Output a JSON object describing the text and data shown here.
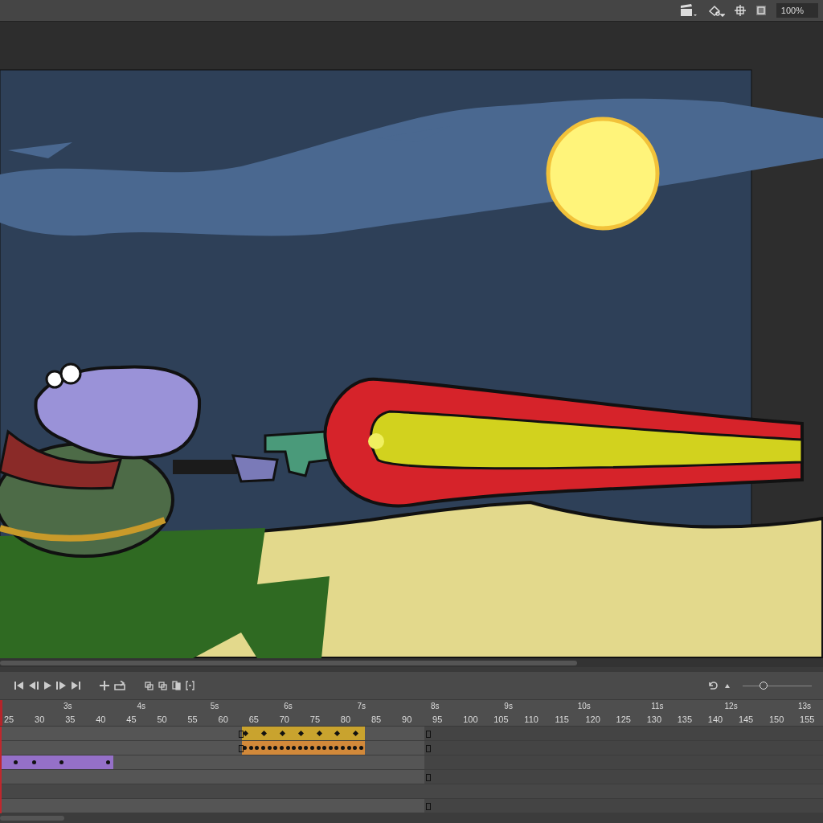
{
  "stage_toolbar": {
    "zoom": "100%"
  },
  "timeline": {
    "frame_labels": [
      "25",
      "30",
      "35",
      "40",
      "45",
      "50",
      "55",
      "60",
      "65",
      "70",
      "75",
      "80",
      "85",
      "90",
      "95",
      "100",
      "105",
      "110",
      "115",
      "120",
      "125",
      "130",
      "135",
      "140",
      "145",
      "150",
      "155"
    ],
    "second_labels": [
      "3s",
      "4s",
      "5s",
      "6s",
      "7s",
      "8s",
      "9s",
      "10s",
      "11s",
      "12s",
      "13s"
    ],
    "zoom_slider": {
      "level": 0.3
    },
    "layers": [
      {
        "kind": "motion-tween"
      },
      {
        "kind": "classic-tween"
      },
      {
        "kind": "shape-tween"
      },
      {
        "kind": "empty"
      },
      {
        "kind": "blank"
      },
      {
        "kind": "empty"
      }
    ]
  }
}
